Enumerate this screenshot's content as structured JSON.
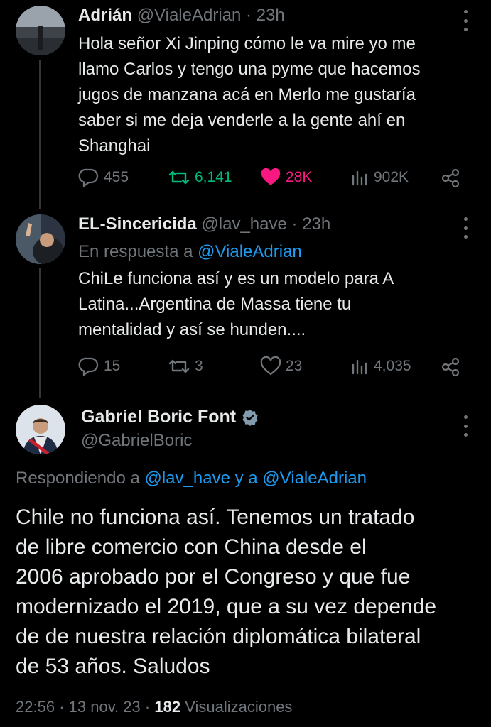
{
  "tweet1": {
    "display_name": "Adrián",
    "handle": "@VialeAdrian",
    "time": "23h",
    "lines": [
      "Hola señor Xi Jinping cómo le va mire yo me",
      "llamo Carlos y tengo una pyme que hacemos",
      "jugos de manzana acá en Merlo me gustaría",
      "saber si me deja venderle a la gente ahí en",
      "Shanghai"
    ],
    "replies": "455",
    "retweets": "6,141",
    "likes": "28K",
    "views": "902K"
  },
  "tweet2": {
    "display_name": "EL-Sincericida",
    "handle": "@lav_have",
    "time": "23h",
    "reply_prefix": "En respuesta a",
    "reply_to": "@VialeAdrian",
    "lines": [
      "ChiLe funciona así y es un modelo para A",
      "Latina...Argentina de Massa tiene tu",
      "mentalidad y así se hunden...."
    ],
    "replies": "15",
    "retweets": "3",
    "likes": "23",
    "views": "4,035"
  },
  "main_tweet": {
    "display_name": "Gabriel Boric Font",
    "handle": "@GabrielBoric",
    "replying_prefix": "Respondiendo a",
    "replying_to_1": "@lav_have",
    "replying_and": "y",
    "replying_a": "a",
    "replying_to_2": "@VialeAdrian",
    "lines": [
      "Chile no funciona así. Tenemos un tratado",
      "de libre comercio con China desde el",
      "2006 aprobado por el Congreso y que fue",
      "modernizado el 2019, que a su vez depende",
      "de de nuestra relación diplomática bilateral",
      "de 53 años. Saludos"
    ],
    "time": "22:56",
    "date": "13 nov. 23",
    "views_count": "182",
    "views_label": "Visualizaciones"
  },
  "colors": {
    "background": "#000000",
    "text": "#e7e9ea",
    "muted": "#71767b",
    "link": "#1d9bf0",
    "retweet_green": "#00ba7c",
    "like_pink": "#f91880",
    "verified_badge": "#829aab"
  },
  "icons": {
    "reply": "reply-icon",
    "retweet": "retweet-icon",
    "like": "heart-icon",
    "views": "views-bar-icon",
    "share": "share-icon",
    "more": "more-icon",
    "verified": "verified-badge-icon"
  }
}
